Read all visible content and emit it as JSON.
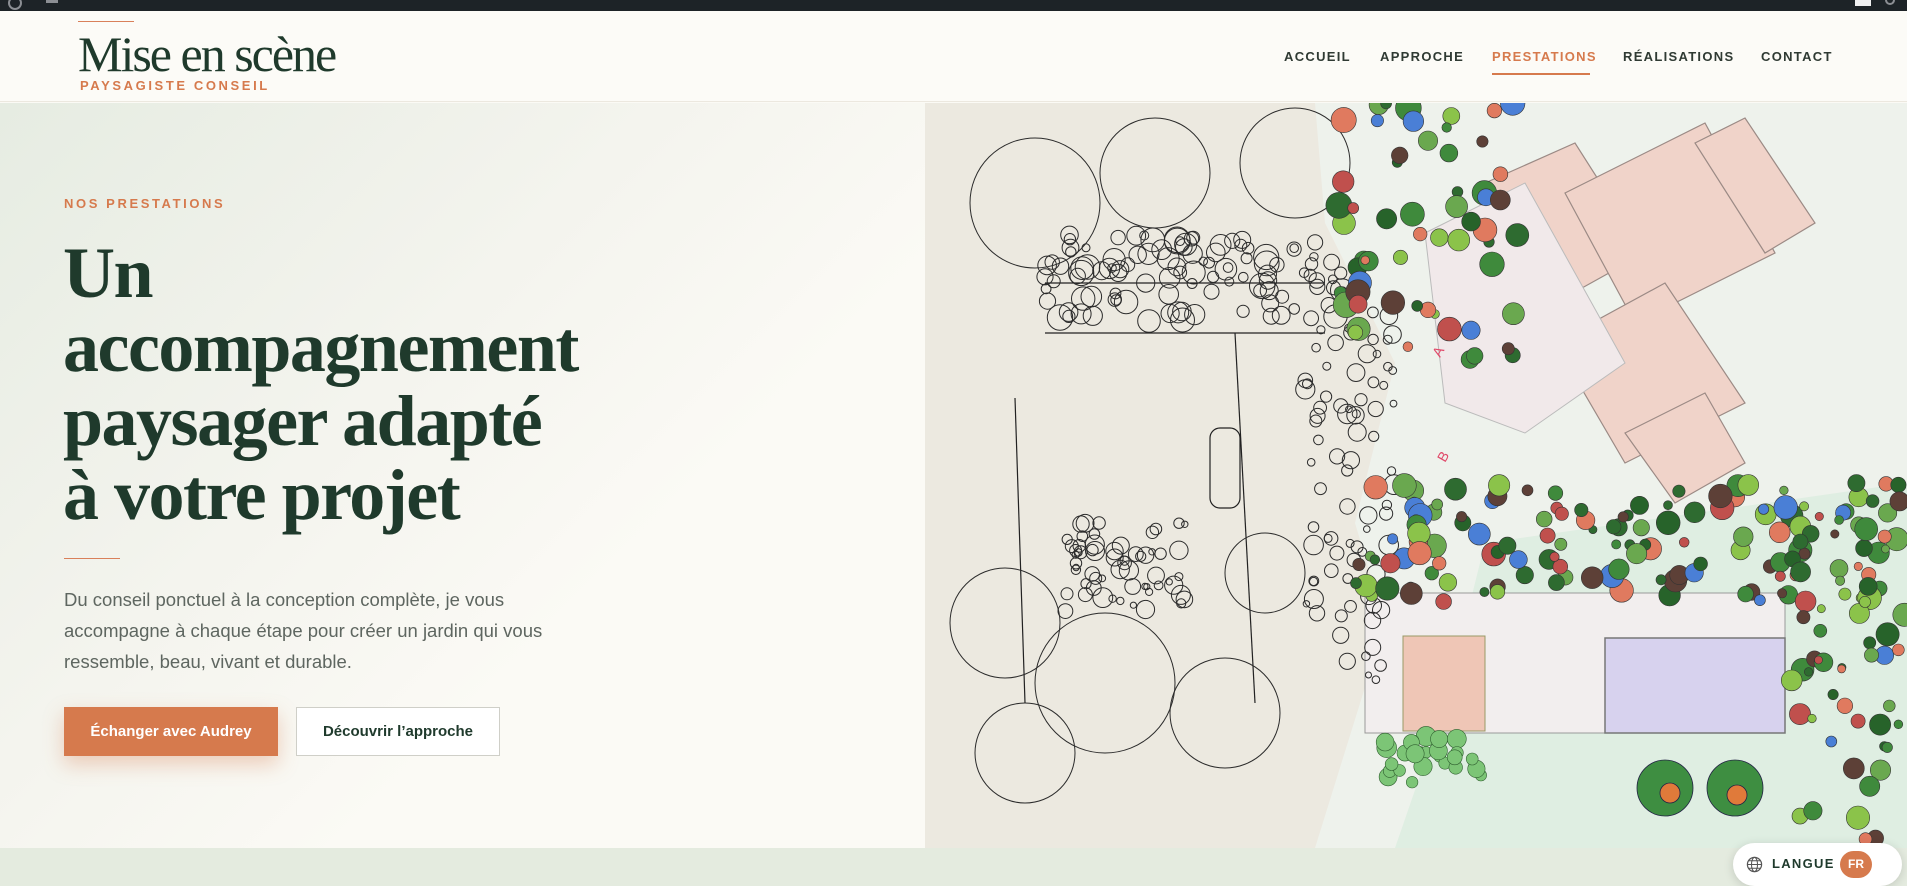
{
  "brand": {
    "title": "Mise en scène",
    "subtitle": "PAYSAGISTE CONSEIL"
  },
  "nav": {
    "items": [
      {
        "label": "ACCUEIL",
        "active": false
      },
      {
        "label": "APPROCHE",
        "active": false
      },
      {
        "label": "PRESTATIONS",
        "active": true
      },
      {
        "label": "RÉALISATIONS",
        "active": false
      },
      {
        "label": "CONTACT",
        "active": false
      }
    ]
  },
  "hero": {
    "eyebrow": "NOS PRESTATIONS",
    "headline_lines": [
      "Un",
      "accompagnement",
      "paysager adapté",
      "à votre projet"
    ],
    "lead_lines": [
      "Du conseil ponctuel à la conception complète, je vous",
      "accompagne à chaque étape pour créer un jardin qui vous",
      "ressemble, beau, vivant et durable."
    ],
    "primary_cta": "Échanger avec Audrey",
    "secondary_cta": "Découvrir l’approche"
  },
  "language": {
    "label": "LANGUE",
    "current": "FR"
  },
  "colors": {
    "accent": "#d67a4d",
    "brand_green": "#1f3a2c",
    "band": "#e4ebdf"
  },
  "icons": {
    "language": "globe-icon"
  }
}
